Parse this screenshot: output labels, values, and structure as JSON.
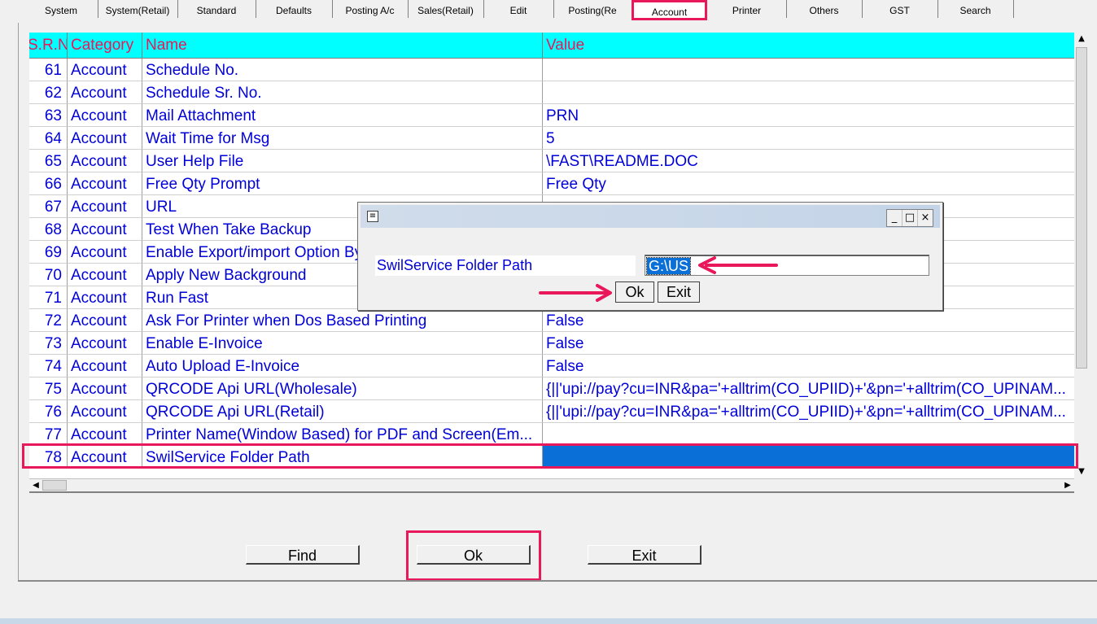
{
  "tabs": [
    {
      "label": "System"
    },
    {
      "label": "System(Retail)"
    },
    {
      "label": "Standard"
    },
    {
      "label": "Defaults"
    },
    {
      "label": "Posting A/c"
    },
    {
      "label": "Sales(Retail)"
    },
    {
      "label": "Edit"
    },
    {
      "label": "Posting(Re"
    },
    {
      "label": "Account"
    },
    {
      "label": "Printer"
    },
    {
      "label": "Others"
    },
    {
      "label": "GST"
    },
    {
      "label": "Search"
    }
  ],
  "active_tab": "Account",
  "grid": {
    "headers": {
      "srno": "S.R.No.",
      "category": "Category",
      "name": "Name",
      "value": "Value"
    },
    "rows": [
      {
        "no": "61",
        "category": "Account",
        "name": "Schedule No.",
        "value": ""
      },
      {
        "no": "62",
        "category": "Account",
        "name": "Schedule Sr. No.",
        "value": ""
      },
      {
        "no": "63",
        "category": "Account",
        "name": "Mail Attachment",
        "value": "PRN"
      },
      {
        "no": "64",
        "category": "Account",
        "name": "Wait Time for Msg",
        "value": "5"
      },
      {
        "no": "65",
        "category": "Account",
        "name": "User Help File",
        "value": "\\FAST\\README.DOC"
      },
      {
        "no": "66",
        "category": "Account",
        "name": "Free Qty Prompt",
        "value": "Free Qty"
      },
      {
        "no": "67",
        "category": "Account",
        "name": "URL",
        "value": ""
      },
      {
        "no": "68",
        "category": "Account",
        "name": "Test When Take Backup",
        "value": ""
      },
      {
        "no": "69",
        "category": "Account",
        "name": "Enable Export/import Option By",
        "value": ""
      },
      {
        "no": "70",
        "category": "Account",
        "name": "Apply New Background",
        "value": ""
      },
      {
        "no": "71",
        "category": "Account",
        "name": "Run Fast",
        "value": ""
      },
      {
        "no": "72",
        "category": "Account",
        "name": "Ask For Printer when Dos Based Printing",
        "value": "False"
      },
      {
        "no": "73",
        "category": "Account",
        "name": "Enable E-Invoice",
        "value": "False"
      },
      {
        "no": "74",
        "category": "Account",
        "name": "Auto Upload E-Invoice",
        "value": "False"
      },
      {
        "no": "75",
        "category": "Account",
        "name": "QRCODE Api URL(Wholesale)",
        "value": "{||'upi://pay?cu=INR&pa='+alltrim(CO_UPIID)+'&pn='+alltrim(CO_UPINAM..."
      },
      {
        "no": "76",
        "category": "Account",
        "name": "QRCODE Api URL(Retail)",
        "value": "{||'upi://pay?cu=INR&pa='+alltrim(CO_UPIID)+'&pn='+alltrim(CO_UPINAM..."
      },
      {
        "no": "77",
        "category": "Account",
        "name": "Printer Name(Window Based) for PDF and Screen(Em...",
        "value": ""
      },
      {
        "no": "78",
        "category": "Account",
        "name": "SwilService Folder Path",
        "value": ""
      }
    ]
  },
  "buttons": {
    "find": "Find",
    "ok": "Ok",
    "exit": "Exit"
  },
  "dialog": {
    "label": "SwilService Folder Path",
    "input_value": "G:\\US",
    "ok": "Ok",
    "exit": "Exit",
    "title_buttons": {
      "minimize": "_",
      "maximize": "□",
      "close": "×"
    }
  },
  "colors": {
    "header_bg": "#00ffff",
    "header_text": "#e8185a",
    "cell_text": "#0000d8",
    "selection": "#0a70d8",
    "annotation": "#e8185a"
  }
}
